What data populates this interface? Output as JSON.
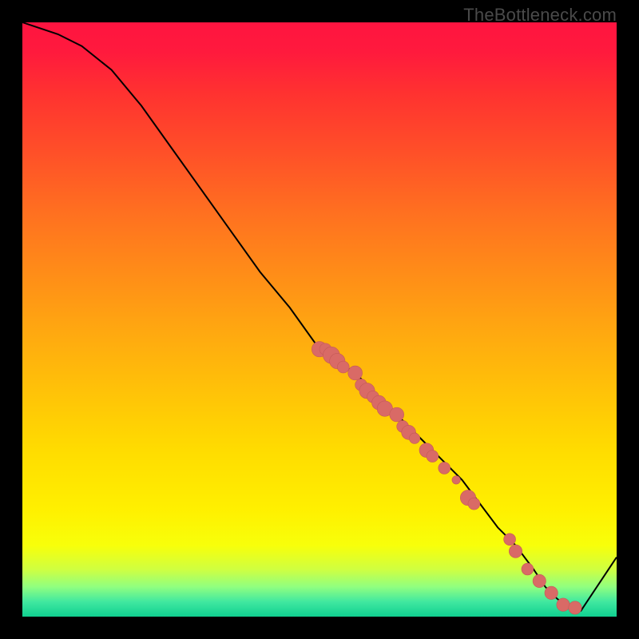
{
  "watermark": "TheBottleneck.com",
  "chart_data": {
    "type": "line",
    "title": "",
    "xlabel": "",
    "ylabel": "",
    "xlim": [
      0,
      100
    ],
    "ylim": [
      0,
      100
    ],
    "curve": {
      "x": [
        0,
        3,
        6,
        10,
        15,
        20,
        25,
        30,
        35,
        40,
        45,
        50,
        53,
        56,
        59,
        62,
        65,
        68,
        71,
        74,
        77,
        80,
        83,
        86,
        88,
        90,
        92,
        94,
        100
      ],
      "y": [
        100,
        99,
        98,
        96,
        92,
        86,
        79,
        72,
        65,
        58,
        52,
        45,
        43,
        41,
        38,
        35,
        32,
        29,
        26,
        23,
        19,
        15,
        12,
        8,
        5,
        3,
        1.5,
        1,
        10
      ]
    },
    "points": [
      {
        "x": 50,
        "y": 45,
        "r": 1.3
      },
      {
        "x": 51,
        "y": 45,
        "r": 1.0
      },
      {
        "x": 52,
        "y": 44,
        "r": 1.4
      },
      {
        "x": 53,
        "y": 43,
        "r": 1.3
      },
      {
        "x": 54,
        "y": 42,
        "r": 1.0
      },
      {
        "x": 56,
        "y": 41,
        "r": 1.2
      },
      {
        "x": 57,
        "y": 39,
        "r": 1.0
      },
      {
        "x": 58,
        "y": 38,
        "r": 1.3
      },
      {
        "x": 59,
        "y": 37,
        "r": 1.0
      },
      {
        "x": 60,
        "y": 36,
        "r": 1.2
      },
      {
        "x": 61,
        "y": 35,
        "r": 1.3
      },
      {
        "x": 63,
        "y": 34,
        "r": 1.2
      },
      {
        "x": 64,
        "y": 32,
        "r": 1.0
      },
      {
        "x": 65,
        "y": 31,
        "r": 1.2
      },
      {
        "x": 66,
        "y": 30,
        "r": 0.9
      },
      {
        "x": 68,
        "y": 28,
        "r": 1.2
      },
      {
        "x": 69,
        "y": 27,
        "r": 1.0
      },
      {
        "x": 71,
        "y": 25,
        "r": 1.0
      },
      {
        "x": 73,
        "y": 23,
        "r": 0.7
      },
      {
        "x": 75,
        "y": 20,
        "r": 1.3
      },
      {
        "x": 76,
        "y": 19,
        "r": 1.0
      },
      {
        "x": 82,
        "y": 13,
        "r": 1.0
      },
      {
        "x": 83,
        "y": 11,
        "r": 1.1
      },
      {
        "x": 85,
        "y": 8,
        "r": 1.0
      },
      {
        "x": 87,
        "y": 6,
        "r": 1.1
      },
      {
        "x": 89,
        "y": 4,
        "r": 1.1
      },
      {
        "x": 91,
        "y": 2,
        "r": 1.1
      },
      {
        "x": 93,
        "y": 1.5,
        "r": 1.1
      }
    ],
    "colors": {
      "line": "#000000",
      "point_fill": "#d96a66",
      "point_stroke": "#c45a56"
    }
  }
}
